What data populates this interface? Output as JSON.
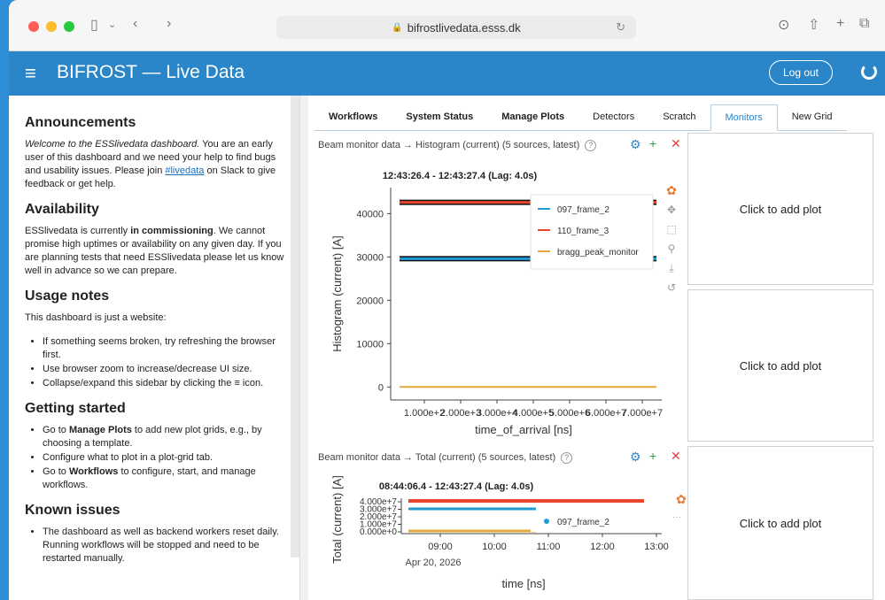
{
  "browser": {
    "url": "bifrostlivedata.esss.dk"
  },
  "app": {
    "title": "BIFROST — Live Data",
    "logout_label": "Log out"
  },
  "sidebar": {
    "announcements_title": "Announcements",
    "announcements_intro": "Welcome to the ESSlivedata dashboard.",
    "announcements_text": " You are an early user of this dashboard and we need your help to find bugs and usability issues. Please join ",
    "announcements_link": "#livedata",
    "announcements_tail": " on Slack to give feedback or get help.",
    "availability_title": "Availability",
    "availability_pre": "ESSlivedata is currently ",
    "availability_bold": "in commissioning",
    "availability_post": ". We cannot promise high uptimes or availability on any given day. If you are planning tests that need ESSlivedata please let us know well in advance so we can prepare.",
    "usage_title": "Usage notes",
    "usage_intro": "This dashboard is just a website:",
    "usage_items": [
      "If something seems broken, try refreshing the browser first.",
      "Use browser zoom to increase/decrease UI size.",
      "Collapse/expand this sidebar by clicking the ≡ icon."
    ],
    "getting_started_title": "Getting started",
    "gs_item1_pre": "Go to ",
    "gs_item1_bold": "Manage Plots",
    "gs_item1_post": " to add new plot grids, e.g., by choosing a template.",
    "gs_item2": "Configure what to plot in a plot-grid tab.",
    "gs_item3_pre": "Go to ",
    "gs_item3_bold": "Workflows",
    "gs_item3_post": " to configure, start, and manage workflows.",
    "known_issues_title": "Known issues",
    "known_issues_item": "The dashboard as well as backend workers reset daily. Running workflows will be stopped and need to be restarted manually."
  },
  "tabs": [
    "Workflows",
    "System Status",
    "Manage Plots",
    "Detectors",
    "Scratch",
    "Monitors",
    "New Grid"
  ],
  "active_tab": "Monitors",
  "plot1": {
    "header": "Beam monitor data → Histogram (current) (5 sources, latest)",
    "title": "12:43:26.4 - 12:43:27.4 (Lag: 4.0s)",
    "ylabel": "Histogram (current) [A]",
    "xlabel": "time_of_arrival [ns]",
    "legend": [
      "097_frame_2",
      "110_frame_3",
      "bragg_peak_monitor"
    ],
    "yticks": [
      "40000",
      "30000",
      "20000",
      "10000",
      "0"
    ],
    "xticks": [
      "1.000e+2",
      "2.000e+3",
      "3.000e+4",
      "4.000e+5",
      "5.000e+6",
      "6.000e+7",
      "7.000e+7"
    ]
  },
  "plot2": {
    "header": "Beam monitor data → Total (current) (5 sources, latest)",
    "title": "08:44:06.4 - 12:43:27.4 (Lag: 4.0s)",
    "ylabel": "Total (current) [A]",
    "xlabel": "time [ns]",
    "legend": [
      "097_frame_2"
    ],
    "yticks": [
      "4.000e+7",
      "3.000e+7",
      "2.000e+7",
      "1.000e+7",
      "0.000e+0"
    ],
    "xticks": [
      "09:00",
      "10:00",
      "11:00",
      "12:00",
      "13:00"
    ],
    "xdate": "Apr 20, 2026"
  },
  "add_plot_label": "Click to add plot",
  "chart_data": [
    {
      "type": "line",
      "title": "12:43:26.4 - 12:43:27.4 (Lag: 4.0s)",
      "xlabel": "time_of_arrival [ns]",
      "ylabel": "Histogram (current) [A]",
      "ylim": [
        -3000,
        46000
      ],
      "series": [
        {
          "name": "097_frame_2",
          "color": "#1f9bd6",
          "values": [
            29600,
            29600
          ]
        },
        {
          "name": "110_frame_3",
          "color": "#e8452c",
          "values": [
            42600,
            42600
          ]
        },
        {
          "name": "bragg_peak_monitor",
          "color": "#e5a93b",
          "values": [
            0,
            0
          ]
        }
      ]
    },
    {
      "type": "scatter",
      "title": "08:44:06.4 - 12:43:27.4 (Lag: 4.0s)",
      "xlabel": "time [ns]",
      "ylabel": "Total (current) [A]",
      "series": [
        {
          "name": "097_frame_2",
          "color": "#1f9bd6"
        }
      ]
    }
  ]
}
